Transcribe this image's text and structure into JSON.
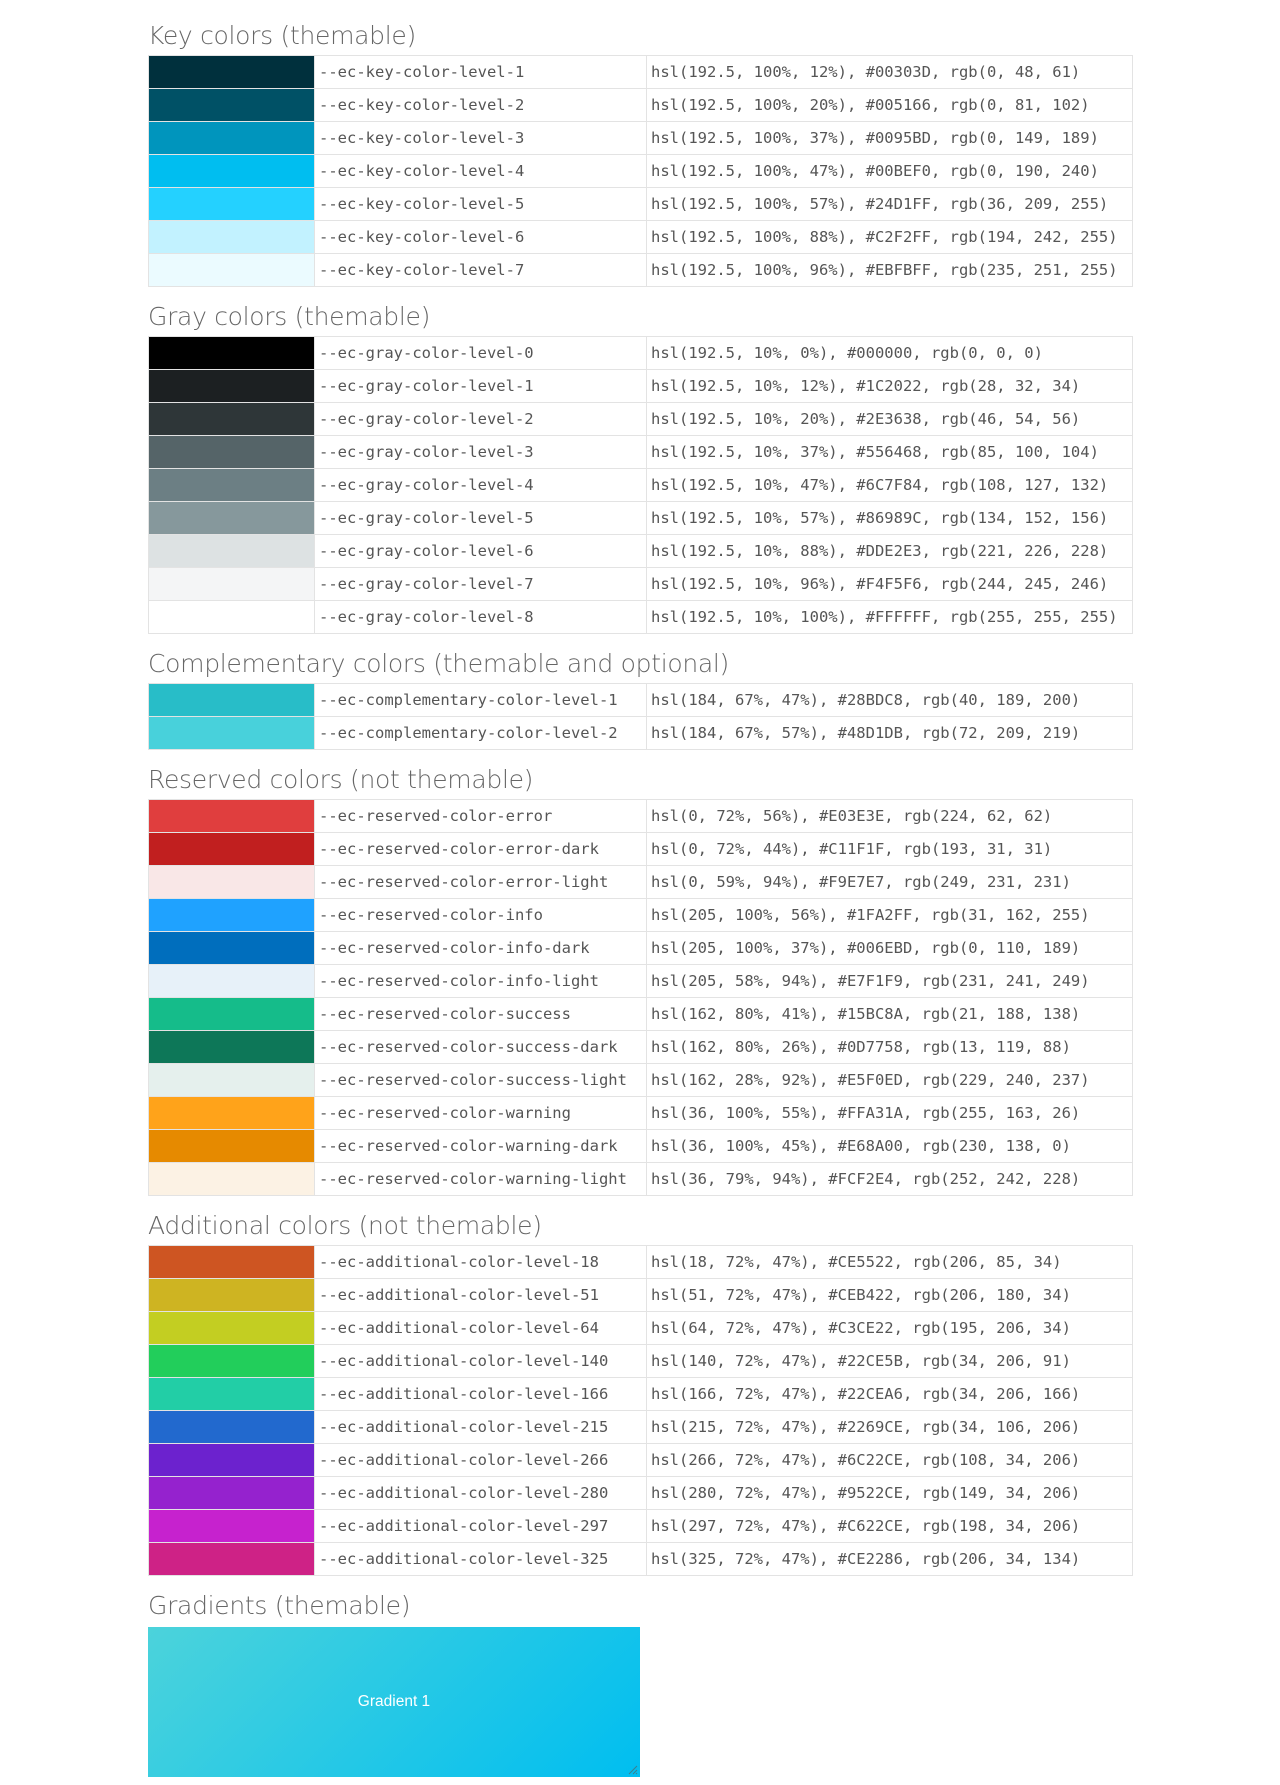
{
  "sections": [
    {
      "title": "Key colors (themable)",
      "rows": [
        {
          "name": "--ec-key-color-level-1",
          "value": "hsl(192.5, 100%, 12%), #00303D, rgb(0, 48, 61)",
          "color": "#00303D"
        },
        {
          "name": "--ec-key-color-level-2",
          "value": "hsl(192.5, 100%, 20%), #005166, rgb(0, 81, 102)",
          "color": "#005166"
        },
        {
          "name": "--ec-key-color-level-3",
          "value": "hsl(192.5, 100%, 37%), #0095BD, rgb(0, 149, 189)",
          "color": "#0095BD"
        },
        {
          "name": "--ec-key-color-level-4",
          "value": "hsl(192.5, 100%, 47%), #00BEF0, rgb(0, 190, 240)",
          "color": "#00BEF0"
        },
        {
          "name": "--ec-key-color-level-5",
          "value": "hsl(192.5, 100%, 57%), #24D1FF, rgb(36, 209, 255)",
          "color": "#24D1FF"
        },
        {
          "name": "--ec-key-color-level-6",
          "value": "hsl(192.5, 100%, 88%), #C2F2FF, rgb(194, 242, 255)",
          "color": "#C2F2FF"
        },
        {
          "name": "--ec-key-color-level-7",
          "value": "hsl(192.5, 100%, 96%), #EBFBFF, rgb(235, 251, 255)",
          "color": "#EBFBFF"
        }
      ]
    },
    {
      "title": "Gray colors (themable)",
      "rows": [
        {
          "name": "--ec-gray-color-level-0",
          "value": "hsl(192.5, 10%, 0%), #000000, rgb(0, 0, 0)",
          "color": "#000000"
        },
        {
          "name": "--ec-gray-color-level-1",
          "value": "hsl(192.5, 10%, 12%), #1C2022, rgb(28, 32, 34)",
          "color": "#1C2022"
        },
        {
          "name": "--ec-gray-color-level-2",
          "value": "hsl(192.5, 10%, 20%), #2E3638, rgb(46, 54, 56)",
          "color": "#2E3638"
        },
        {
          "name": "--ec-gray-color-level-3",
          "value": "hsl(192.5, 10%, 37%), #556468, rgb(85, 100, 104)",
          "color": "#556468"
        },
        {
          "name": "--ec-gray-color-level-4",
          "value": "hsl(192.5, 10%, 47%), #6C7F84, rgb(108, 127, 132)",
          "color": "#6C7F84"
        },
        {
          "name": "--ec-gray-color-level-5",
          "value": "hsl(192.5, 10%, 57%), #86989C, rgb(134, 152, 156)",
          "color": "#86989C"
        },
        {
          "name": "--ec-gray-color-level-6",
          "value": "hsl(192.5, 10%, 88%), #DDE2E3, rgb(221, 226, 228)",
          "color": "#DDE2E3"
        },
        {
          "name": "--ec-gray-color-level-7",
          "value": "hsl(192.5, 10%, 96%), #F4F5F6, rgb(244, 245, 246)",
          "color": "#F4F5F6"
        },
        {
          "name": "--ec-gray-color-level-8",
          "value": "hsl(192.5, 10%, 100%), #FFFFFF, rgb(255, 255, 255)",
          "color": "#FFFFFF"
        }
      ]
    },
    {
      "title": "Complementary colors (themable and optional)",
      "rows": [
        {
          "name": "--ec-complementary-color-level-1",
          "value": "hsl(184, 67%, 47%), #28BDC8, rgb(40, 189, 200)",
          "color": "#28BDC8"
        },
        {
          "name": "--ec-complementary-color-level-2",
          "value": "hsl(184, 67%, 57%), #48D1DB, rgb(72, 209, 219)",
          "color": "#48D1DB"
        }
      ]
    },
    {
      "title": "Reserved colors (not themable)",
      "rows": [
        {
          "name": "--ec-reserved-color-error",
          "value": "hsl(0, 72%, 56%), #E03E3E, rgb(224, 62, 62)",
          "color": "#E03E3E"
        },
        {
          "name": "--ec-reserved-color-error-dark",
          "value": "hsl(0, 72%, 44%), #C11F1F, rgb(193, 31, 31)",
          "color": "#C11F1F"
        },
        {
          "name": "--ec-reserved-color-error-light",
          "value": "hsl(0, 59%, 94%), #F9E7E7, rgb(249, 231, 231)",
          "color": "#F9E7E7"
        },
        {
          "name": "--ec-reserved-color-info",
          "value": "hsl(205, 100%, 56%), #1FA2FF, rgb(31, 162, 255)",
          "color": "#1FA2FF"
        },
        {
          "name": "--ec-reserved-color-info-dark",
          "value": "hsl(205, 100%, 37%), #006EBD, rgb(0, 110, 189)",
          "color": "#006EBD"
        },
        {
          "name": "--ec-reserved-color-info-light",
          "value": "hsl(205, 58%, 94%), #E7F1F9, rgb(231, 241, 249)",
          "color": "#E7F1F9"
        },
        {
          "name": "--ec-reserved-color-success",
          "value": "hsl(162, 80%, 41%), #15BC8A, rgb(21, 188, 138)",
          "color": "#15BC8A"
        },
        {
          "name": "--ec-reserved-color-success-dark",
          "value": "hsl(162, 80%, 26%), #0D7758, rgb(13, 119, 88)",
          "color": "#0D7758"
        },
        {
          "name": "--ec-reserved-color-success-light",
          "value": "hsl(162, 28%, 92%), #E5F0ED, rgb(229, 240, 237)",
          "color": "#E5F0ED"
        },
        {
          "name": "--ec-reserved-color-warning",
          "value": "hsl(36, 100%, 55%), #FFA31A, rgb(255, 163, 26)",
          "color": "#FFA31A"
        },
        {
          "name": "--ec-reserved-color-warning-dark",
          "value": "hsl(36, 100%, 45%), #E68A00, rgb(230, 138, 0)",
          "color": "#E68A00"
        },
        {
          "name": "--ec-reserved-color-warning-light",
          "value": "hsl(36, 79%, 94%), #FCF2E4, rgb(252, 242, 228)",
          "color": "#FCF2E4"
        }
      ]
    },
    {
      "title": "Additional colors (not themable)",
      "rows": [
        {
          "name": "--ec-additional-color-level-18",
          "value": "hsl(18, 72%, 47%), #CE5522, rgb(206, 85, 34)",
          "color": "#CE5522"
        },
        {
          "name": "--ec-additional-color-level-51",
          "value": "hsl(51, 72%, 47%), #CEB422, rgb(206, 180, 34)",
          "color": "#CEB422"
        },
        {
          "name": "--ec-additional-color-level-64",
          "value": "hsl(64, 72%, 47%), #C3CE22, rgb(195, 206, 34)",
          "color": "#C3CE22"
        },
        {
          "name": "--ec-additional-color-level-140",
          "value": "hsl(140, 72%, 47%), #22CE5B, rgb(34, 206, 91)",
          "color": "#22CE5B"
        },
        {
          "name": "--ec-additional-color-level-166",
          "value": "hsl(166, 72%, 47%), #22CEA6, rgb(34, 206, 166)",
          "color": "#22CEA6"
        },
        {
          "name": "--ec-additional-color-level-215",
          "value": "hsl(215, 72%, 47%), #2269CE, rgb(34, 106, 206)",
          "color": "#2269CE"
        },
        {
          "name": "--ec-additional-color-level-266",
          "value": "hsl(266, 72%, 47%), #6C22CE, rgb(108, 34, 206)",
          "color": "#6C22CE"
        },
        {
          "name": "--ec-additional-color-level-280",
          "value": "hsl(280, 72%, 47%), #9522CE, rgb(149, 34, 206)",
          "color": "#9522CE"
        },
        {
          "name": "--ec-additional-color-level-297",
          "value": "hsl(297, 72%, 47%), #C622CE, rgb(198, 34, 206)",
          "color": "#C622CE"
        },
        {
          "name": "--ec-additional-color-level-325",
          "value": "hsl(325, 72%, 47%), #CE2286, rgb(206, 34, 134)",
          "color": "#CE2286"
        }
      ]
    }
  ],
  "gradients": {
    "title": "Gradients (themable)",
    "items": [
      {
        "label": "Gradient 1",
        "color_from": "#4CD3DB",
        "color_to": "#00BEF0"
      }
    ]
  }
}
